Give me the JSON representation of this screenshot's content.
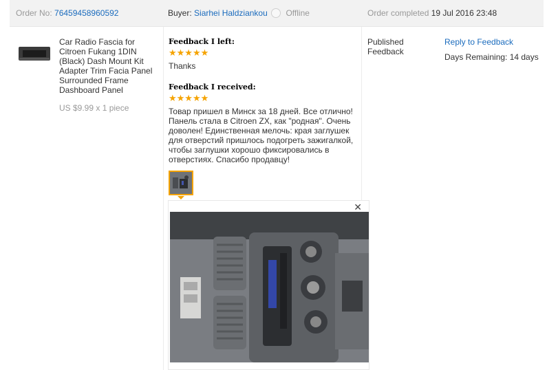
{
  "header": {
    "order_label": "Order No:",
    "order_number": "76459458960592",
    "buyer_label": "Buyer:",
    "buyer_name": "Siarhei Haldziankou",
    "buyer_status": "Offline",
    "completed_label": "Order completed",
    "completed_date": "19 Jul 2016 23:48"
  },
  "product": {
    "title": "Car Radio Fascia for Citroen Fukang 1DIN (Black) Dash Mount Kit Adapter Trim Facia Panel Surrounded Frame Dashboard Panel",
    "price": "US $9.99 x 1 piece"
  },
  "feedback_left": {
    "heading": "Feedback I left:",
    "stars": "★★★★★",
    "text": "Thanks"
  },
  "feedback_received": {
    "heading": "Feedback I received:",
    "stars": "★★★★★",
    "text": "Товар пришел в Минск за 18 дней. Все отлично! Панель стала в Citroen ZX, как \"родная\". Очень доволен! Единственная мелочь: края заглушек для отверстий пришлось подогреть зажигалкой, чтобы заглушки хорошо фиксировались в отверстиях. Спасибо продавцу!"
  },
  "preview": {
    "close": "✕"
  },
  "status": {
    "published": "Published Feedback",
    "reply_link": "Reply to Feedback",
    "days_remaining": "Days Remaining: 14 days"
  },
  "colors": {
    "link": "#1a6bbd",
    "star": "#f5a300",
    "header_bg": "#f2f2f2"
  }
}
